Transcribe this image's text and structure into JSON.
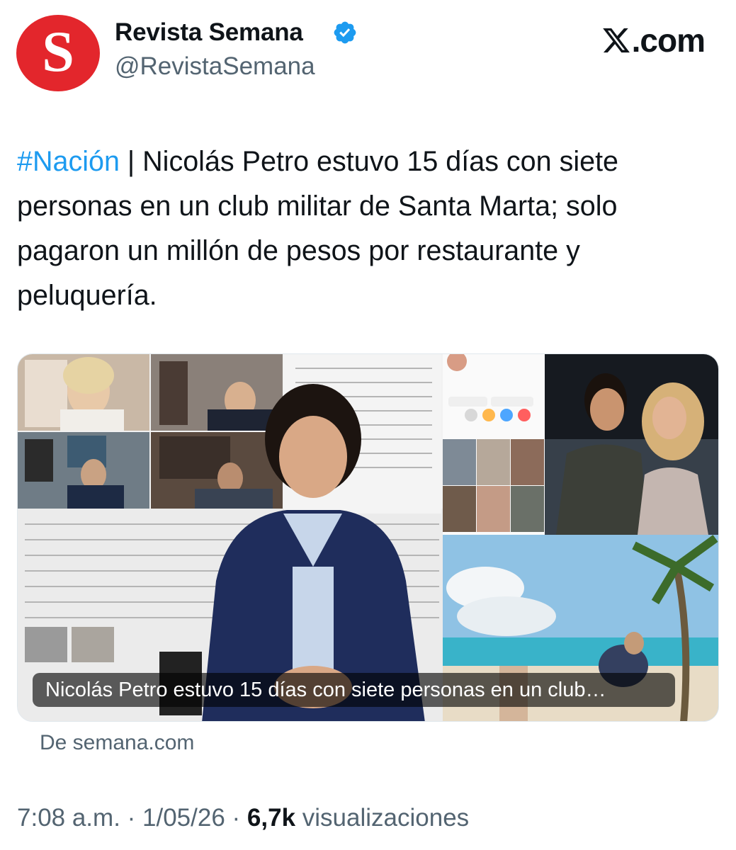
{
  "account": {
    "avatar_letter": "S",
    "display_name": "Revista Semana",
    "handle": "@RevistaSemana",
    "verified": true,
    "avatar_color": "#e3262c",
    "verified_color": "#1d9bf0"
  },
  "site": {
    "label": ".com"
  },
  "tweet": {
    "hashtag": "#Nación",
    "separator": " | ",
    "text": "Nicolás Petro estuvo 15 días con siete personas en un club militar de Santa Marta; solo pagaron un millón de pesos por restaurante y peluquería."
  },
  "card": {
    "caption": "Nicolás Petro estuvo 15 días con siete personas en un club…",
    "source": "De semana.com"
  },
  "meta": {
    "time": "7:08 a.m.",
    "date": "1/05/26",
    "views_count": "6,7k",
    "views_label": "visualizaciones",
    "dot": " · "
  },
  "colors": {
    "link": "#1d9bf0",
    "secondary_text": "#536471",
    "primary_text": "#0f1419"
  }
}
